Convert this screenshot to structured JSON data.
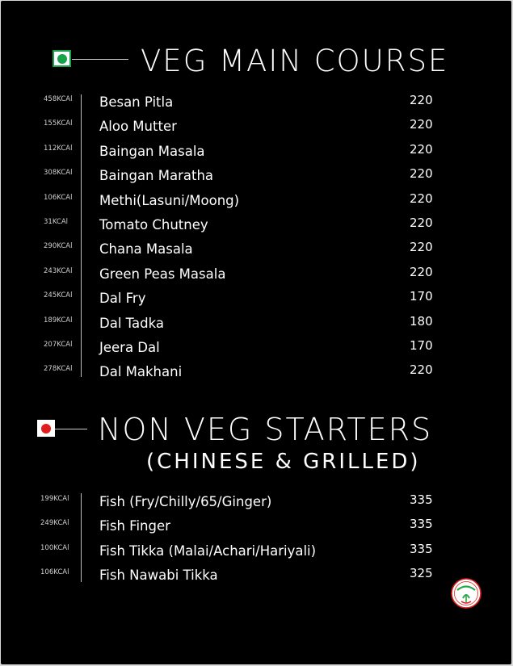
{
  "sections": [
    {
      "title": "VEG MAIN COURSE",
      "subtitle": "",
      "marker_color": "#17a34a",
      "items": [
        {
          "kcal": "458KCAl",
          "name": "Besan Pitla",
          "price": "220"
        },
        {
          "kcal": "155KCAl",
          "name": "Aloo Mutter",
          "price": "220"
        },
        {
          "kcal": "112KCAl",
          "name": "Baingan Masala",
          "price": "220"
        },
        {
          "kcal": "308KCAl",
          "name": "Baingan Maratha",
          "price": "220"
        },
        {
          "kcal": "106KCAl",
          "name": "Methi(Lasuni/Moong)",
          "price": "220"
        },
        {
          "kcal": "31KCAl",
          "name": "Tomato Chutney",
          "price": "220"
        },
        {
          "kcal": "290KCAl",
          "name": "Chana Masala",
          "price": "220"
        },
        {
          "kcal": "243KCAl",
          "name": "Green Peas Masala",
          "price": "220"
        },
        {
          "kcal": "245KCAl",
          "name": "Dal Fry",
          "price": "170"
        },
        {
          "kcal": "189KCAl",
          "name": "Dal Tadka",
          "price": "180"
        },
        {
          "kcal": "207KCAl",
          "name": "Jeera Dal",
          "price": "170"
        },
        {
          "kcal": "278KCAl",
          "name": "Dal Makhani",
          "price": "220"
        }
      ]
    },
    {
      "title": "NON VEG STARTERS",
      "subtitle": "(CHINESE & GRILLED)",
      "marker_color": "#e11d1d",
      "items": [
        {
          "kcal": "199KCAl",
          "name": "Fish (Fry/Chilly/65/Ginger)",
          "price": "335"
        },
        {
          "kcal": "249KCAl",
          "name": "Fish Finger",
          "price": "335"
        },
        {
          "kcal": "100KCAl",
          "name": "Fish Tikka (Malai/Achari/Hariyali)",
          "price": "335"
        },
        {
          "kcal": "106KCAl",
          "name": "Fish Nawabi Tikka",
          "price": "325"
        }
      ]
    }
  ],
  "colors": {
    "background": "#000000",
    "text": "#ffffff",
    "logo_red": "#e02020",
    "logo_green": "#2aa845"
  },
  "logo": {
    "icon": "brand-logo-icon"
  }
}
